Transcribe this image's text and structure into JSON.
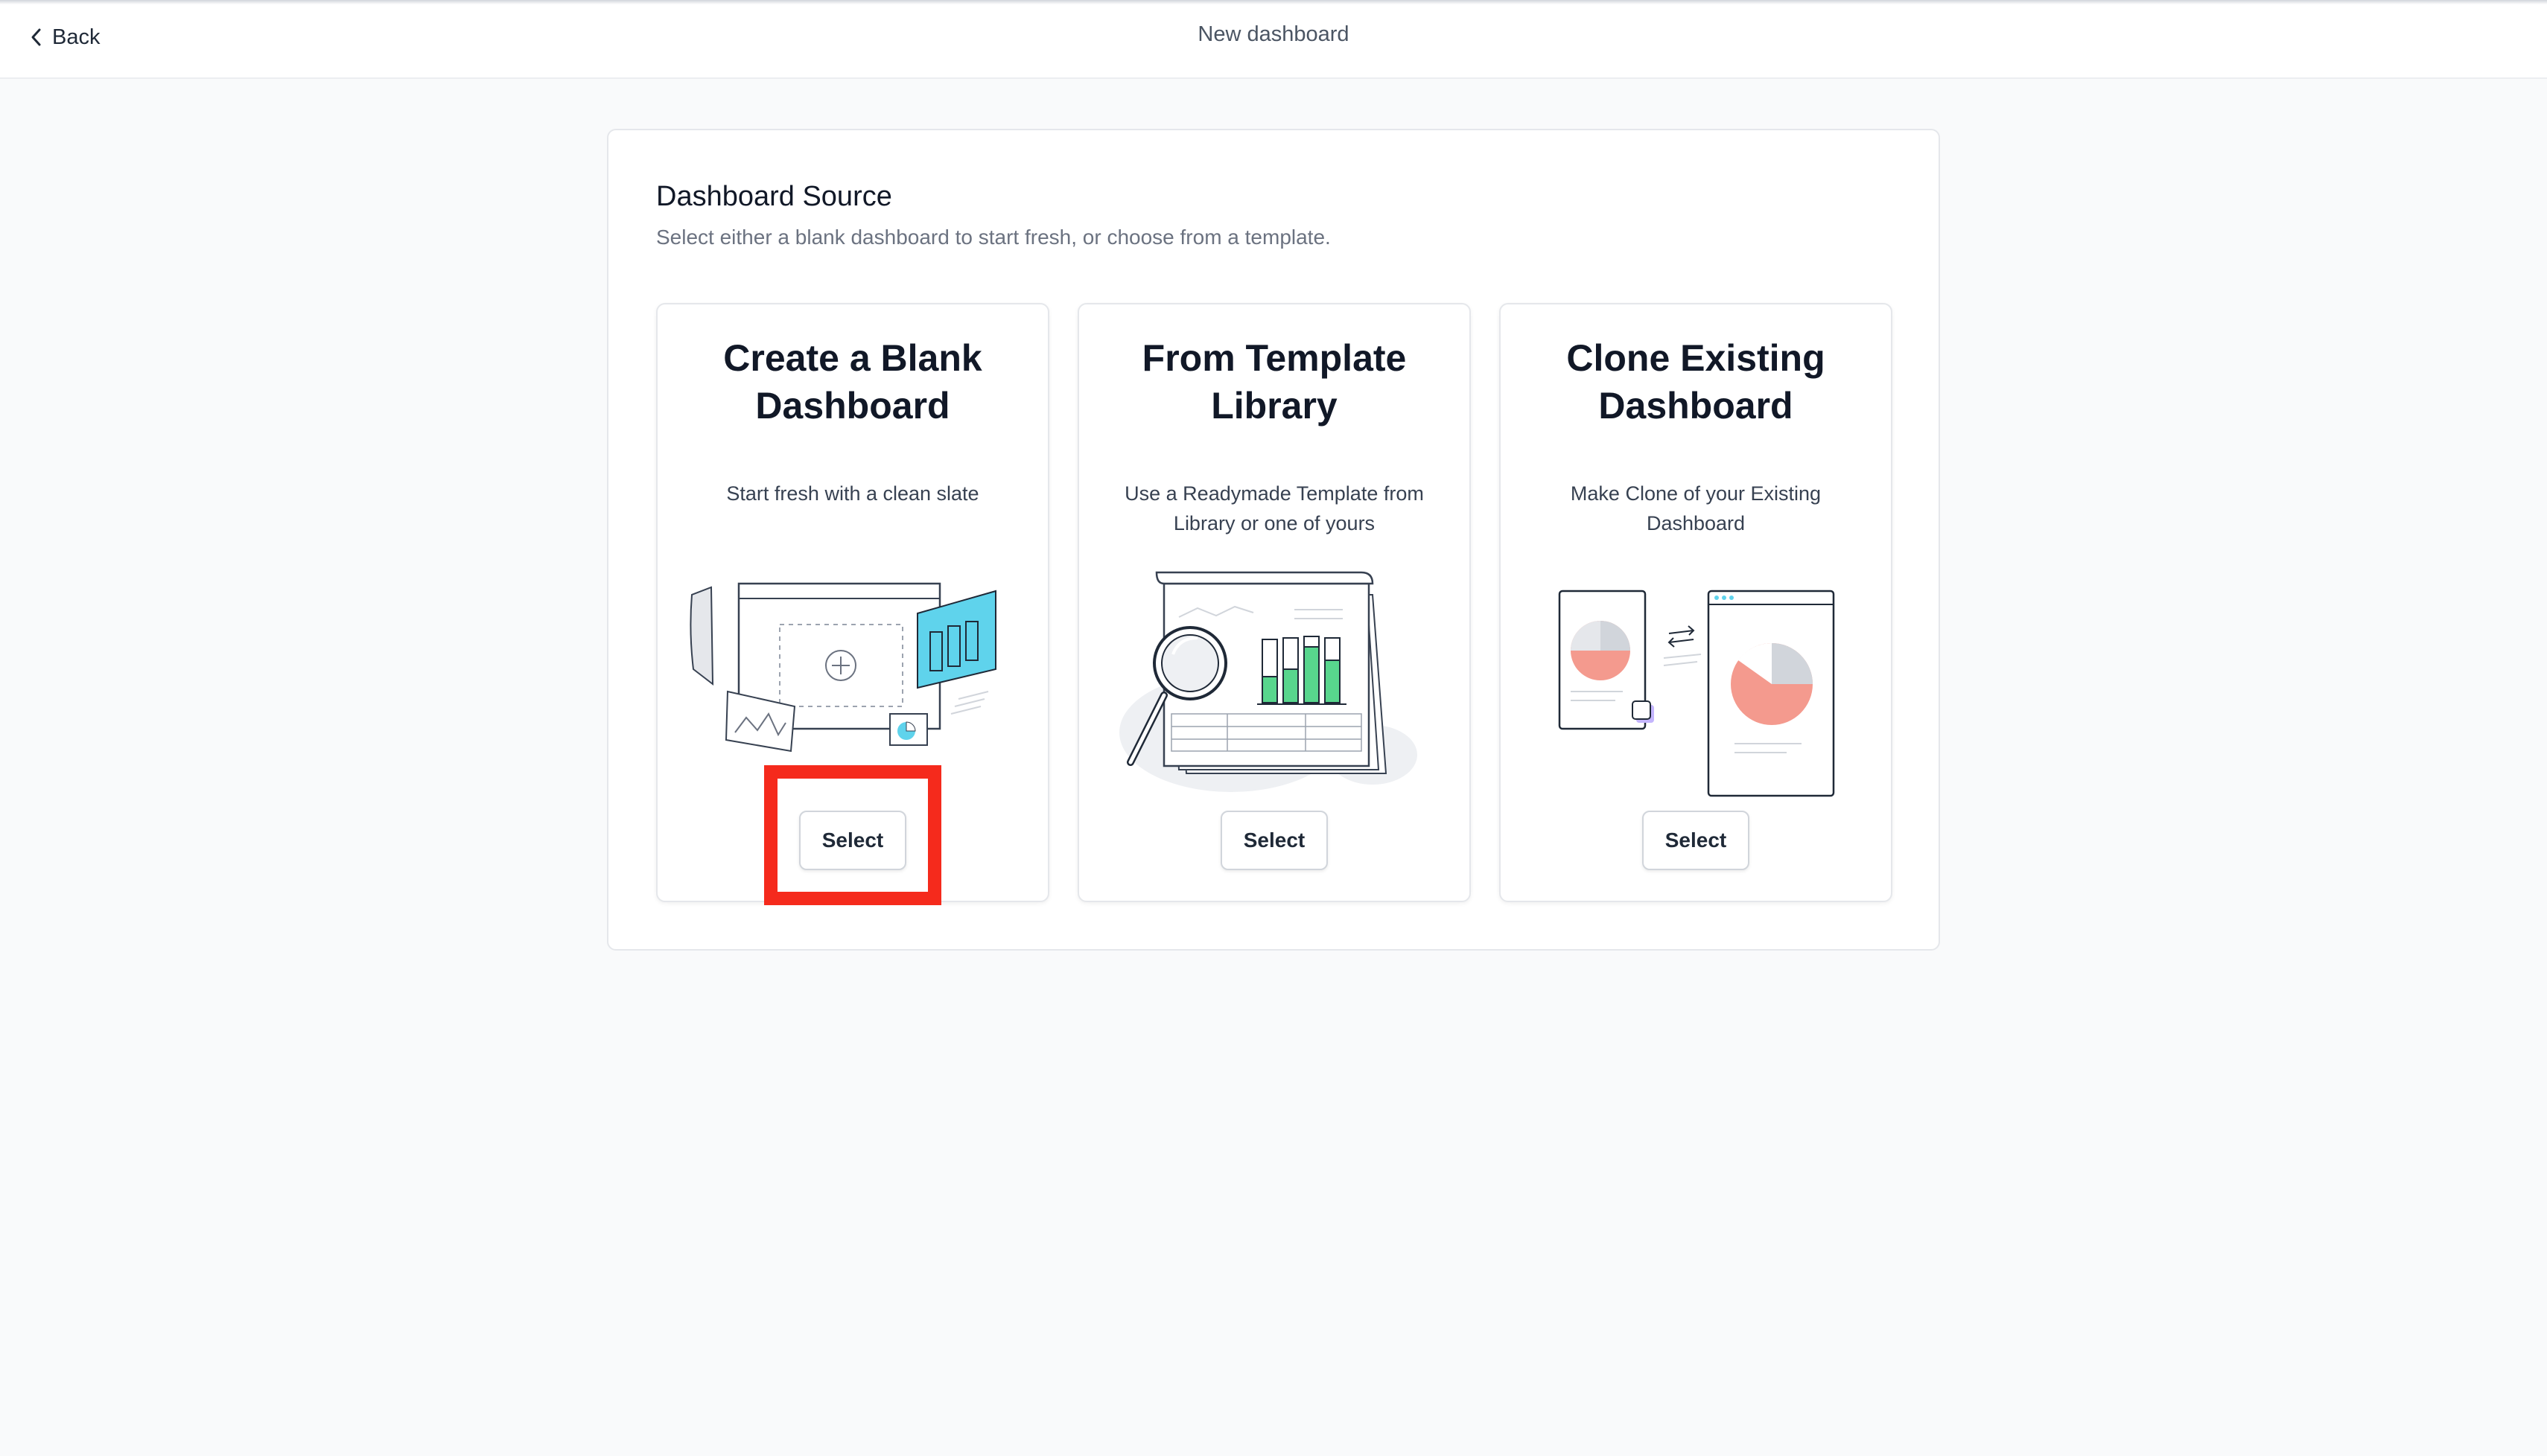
{
  "header": {
    "back_label": "Back",
    "title": "New dashboard"
  },
  "panel": {
    "title": "Dashboard Source",
    "subtitle": "Select either a blank dashboard to start fresh, or choose from a template."
  },
  "cards": [
    {
      "title": "Create a Blank Dashboard",
      "description": "Start fresh with a clean slate",
      "button_label": "Select",
      "illustration": "blank-dashboard-illustration"
    },
    {
      "title": "From Template Library",
      "description": "Use a Readymade Template from Library or one of yours",
      "button_label": "Select",
      "illustration": "template-library-illustration"
    },
    {
      "title": "Clone Existing Dashboard",
      "description": "Make Clone of your Existing Dashboard",
      "button_label": "Select",
      "illustration": "clone-dashboard-illustration"
    }
  ],
  "colors": {
    "accent_cyan": "#5fd3ec",
    "accent_green": "#58d68d",
    "accent_salmon": "#f49a8e",
    "highlight_red": "#f52a1c"
  }
}
